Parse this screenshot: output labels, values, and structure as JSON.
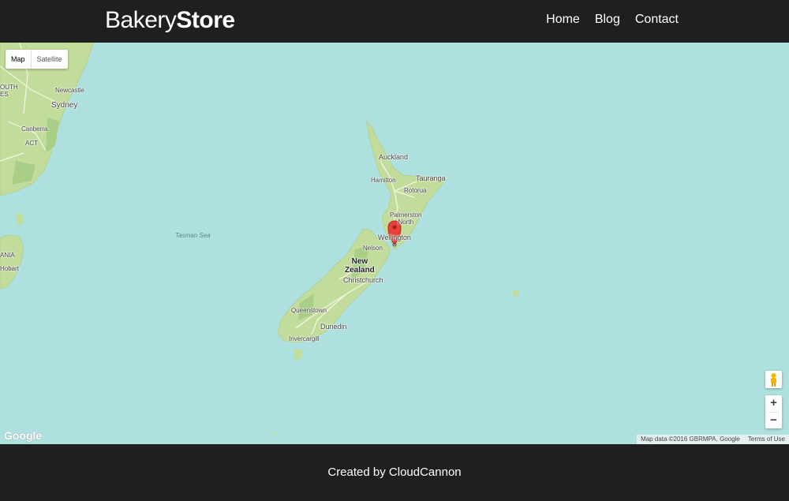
{
  "header": {
    "logo_light": "Bakery",
    "logo_bold": "Store",
    "nav": [
      "Home",
      "Blog",
      "Contact"
    ]
  },
  "map": {
    "type_control": [
      "Map",
      "Satellite"
    ],
    "labels": {
      "south_wales": "OUTH\nES",
      "newcastle": "Newcastle",
      "sydney": "Sydney",
      "canberra": "Canberra",
      "act": "ACT",
      "tasmania": "ANIA",
      "hobart": "Hobart",
      "tasman_sea": "Tasman Sea",
      "auckland": "Auckland",
      "hamilton": "Hamilton",
      "tauranga": "Tauranga",
      "rotorua": "Rotorua",
      "palmerston_north": "Palmerston\nNorth",
      "wellington": "Wellington",
      "nelson": "Nelson",
      "new_zealand": "New\nZealand",
      "christchurch": "Christchurch",
      "queenstown": "Queenstown",
      "dunedin": "Dunedin",
      "invercargill": "Invercargill"
    },
    "zoom_in": "+",
    "zoom_out": "−",
    "google_logo": "Google",
    "map_data": "Map data ©2016 GBRMPA, Google",
    "terms": "Terms of Use",
    "colors": {
      "water": "#aee0df",
      "land": "#c2dc9c",
      "marker": "#e8413a"
    }
  },
  "footer": {
    "text": "Created by CloudCannon"
  }
}
